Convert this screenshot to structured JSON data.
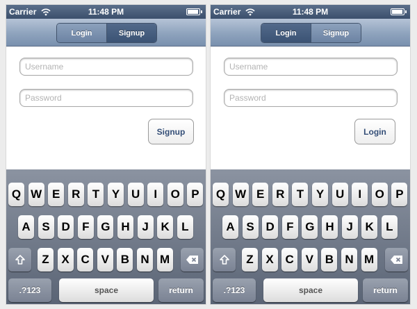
{
  "phones": [
    {
      "status": {
        "carrier": "Carrier",
        "time": "11:48 PM"
      },
      "segments": [
        "Login",
        "Signup"
      ],
      "selected_segment": "Signup",
      "username_placeholder": "Username",
      "password_placeholder": "Password",
      "action_label": "Signup"
    },
    {
      "status": {
        "carrier": "Carrier",
        "time": "11:48 PM"
      },
      "segments": [
        "Login",
        "Signup"
      ],
      "selected_segment": "Login",
      "username_placeholder": "Username",
      "password_placeholder": "Password",
      "action_label": "Login"
    }
  ],
  "keyboard": {
    "row1": [
      "Q",
      "W",
      "E",
      "R",
      "T",
      "Y",
      "U",
      "I",
      "O",
      "P"
    ],
    "row2": [
      "A",
      "S",
      "D",
      "F",
      "G",
      "H",
      "J",
      "K",
      "L"
    ],
    "row3": [
      "Z",
      "X",
      "C",
      "V",
      "B",
      "N",
      "M"
    ],
    "shift_icon": "shift-icon",
    "delete_icon": "delete-icon",
    "numbers_label": ".?123",
    "space_label": "space",
    "return_label": "return"
  },
  "colors": {
    "nav_bar": "#8ea3bd",
    "segment_selected": "#3b5374",
    "action_text": "#344e77",
    "keyboard_bg": "#6d7686"
  }
}
